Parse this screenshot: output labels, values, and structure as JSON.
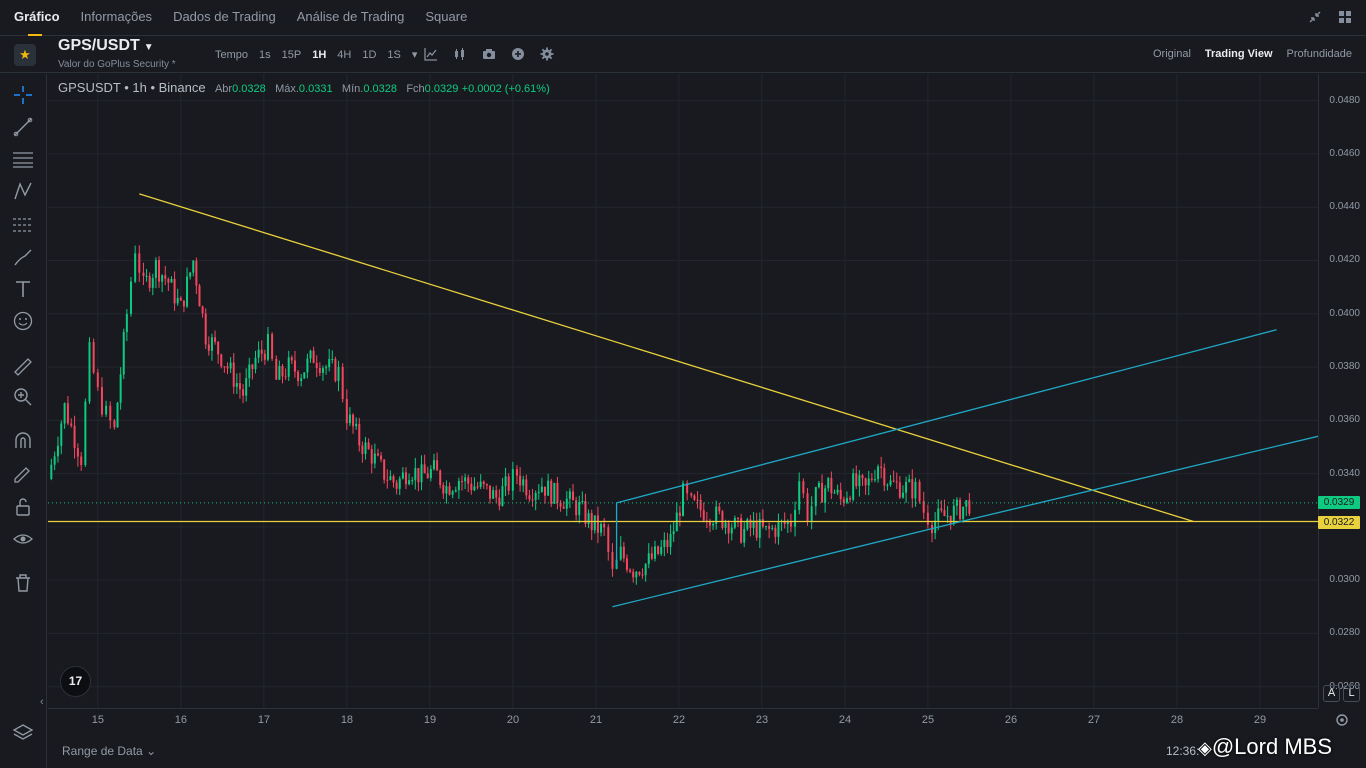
{
  "nav": {
    "tabs": [
      "Gráfico",
      "Informações",
      "Dados de Trading",
      "Análise de Trading",
      "Square"
    ]
  },
  "header": {
    "symbol": "GPS/USDT",
    "subtitle": "Valor do GoPlus Security *",
    "time_label": "Tempo",
    "intervals": [
      "1s",
      "15P",
      "1H",
      "4H",
      "1D",
      "1S"
    ],
    "active_interval": "1H",
    "views": [
      "Original",
      "Trading View",
      "Profundidade"
    ],
    "active_view": "Trading View"
  },
  "legend": {
    "title": "GPSUSDT • 1h • Binance",
    "open_label": "Abr",
    "open": "0.0328",
    "high_label": "Máx.",
    "high": "0.0331",
    "low_label": "Mín.",
    "low": "0.0328",
    "close_label": "Fch",
    "close": "0.0329",
    "change": "+0.0002 (+0.61%)"
  },
  "y_axis": [
    "0.0480",
    "0.0460",
    "0.0440",
    "0.0420",
    "0.0400",
    "0.0380",
    "0.0360",
    "0.0340",
    "0.0320",
    "0.0300",
    "0.0280",
    "0.0260"
  ],
  "x_axis": [
    "15",
    "16",
    "17",
    "18",
    "19",
    "20",
    "21",
    "22",
    "23",
    "24",
    "25",
    "26",
    "27",
    "28",
    "29"
  ],
  "price_tags": {
    "current": "0.0329",
    "level": "0.0322"
  },
  "colors": {
    "up": "#0ecb81",
    "down": "#f6465d",
    "trendline": "#e8d13c",
    "channel": "#1fa8c4",
    "accent": "#f0b90b"
  },
  "bottom": {
    "range_label": "Range de Data",
    "clock": "12:36:",
    "watermark": "@Lord MBS"
  },
  "scale_buttons": [
    "A",
    "L"
  ],
  "tv_logo": "17",
  "chart_data": {
    "type": "candlestick",
    "symbol": "GPSUSDT",
    "interval": "1h",
    "ylim": [
      0.0252,
      0.049
    ],
    "xlim": [
      14.4,
      29.7
    ],
    "closes": [
      [
        14.4,
        0.0338
      ],
      [
        14.6,
        0.0365
      ],
      [
        14.8,
        0.0346
      ],
      [
        14.9,
        0.0385
      ],
      [
        15.0,
        0.037
      ],
      [
        15.1,
        0.0362
      ],
      [
        15.2,
        0.0356
      ],
      [
        15.35,
        0.04
      ],
      [
        15.45,
        0.0425
      ],
      [
        15.55,
        0.041
      ],
      [
        15.7,
        0.0418
      ],
      [
        15.85,
        0.0412
      ],
      [
        16.0,
        0.0402
      ],
      [
        16.15,
        0.042
      ],
      [
        16.3,
        0.0392
      ],
      [
        16.45,
        0.0386
      ],
      [
        16.6,
        0.0378
      ],
      [
        16.75,
        0.037
      ],
      [
        16.9,
        0.0383
      ],
      [
        17.05,
        0.0388
      ],
      [
        17.15,
        0.0375
      ],
      [
        17.3,
        0.038
      ],
      [
        17.45,
        0.0378
      ],
      [
        17.6,
        0.0384
      ],
      [
        17.75,
        0.038
      ],
      [
        17.9,
        0.0378
      ],
      [
        18.0,
        0.0362
      ],
      [
        18.15,
        0.0352
      ],
      [
        18.3,
        0.0347
      ],
      [
        18.45,
        0.034
      ],
      [
        18.6,
        0.0336
      ],
      [
        18.75,
        0.0342
      ],
      [
        18.9,
        0.0339
      ],
      [
        19.05,
        0.0341
      ],
      [
        19.2,
        0.0335
      ],
      [
        19.35,
        0.0338
      ],
      [
        19.5,
        0.0336
      ],
      [
        19.65,
        0.0334
      ],
      [
        19.8,
        0.0331
      ],
      [
        19.95,
        0.0336
      ],
      [
        20.05,
        0.034
      ],
      [
        20.2,
        0.0334
      ],
      [
        20.35,
        0.0336
      ],
      [
        20.5,
        0.0332
      ],
      [
        20.65,
        0.033
      ],
      [
        20.8,
        0.0327
      ],
      [
        20.95,
        0.0321
      ],
      [
        21.1,
        0.0318
      ],
      [
        21.2,
        0.0302
      ],
      [
        21.3,
        0.031
      ],
      [
        21.45,
        0.0304
      ],
      [
        21.6,
        0.0306
      ],
      [
        21.75,
        0.031
      ],
      [
        21.9,
        0.0315
      ],
      [
        22.05,
        0.0332
      ],
      [
        22.15,
        0.0328
      ],
      [
        22.3,
        0.0326
      ],
      [
        22.45,
        0.0324
      ],
      [
        22.6,
        0.0322
      ],
      [
        22.75,
        0.0318
      ],
      [
        22.9,
        0.032
      ],
      [
        23.05,
        0.0318
      ],
      [
        23.2,
        0.032
      ],
      [
        23.35,
        0.0322
      ],
      [
        23.45,
        0.0338
      ],
      [
        23.55,
        0.0325
      ],
      [
        23.65,
        0.0331
      ],
      [
        23.8,
        0.0336
      ],
      [
        23.95,
        0.033
      ],
      [
        24.1,
        0.0336
      ],
      [
        24.25,
        0.0334
      ],
      [
        24.4,
        0.0344
      ],
      [
        24.55,
        0.0336
      ],
      [
        24.7,
        0.0335
      ],
      [
        24.85,
        0.0334
      ],
      [
        24.95,
        0.0326
      ],
      [
        25.05,
        0.0322
      ],
      [
        25.2,
        0.0324
      ],
      [
        25.35,
        0.0326
      ],
      [
        25.5,
        0.0329
      ]
    ],
    "trendline_desc": [
      [
        15.5,
        0.0445
      ],
      [
        28.2,
        0.0322
      ]
    ],
    "horizontal_level": 0.0322,
    "channel_lines": [
      [
        [
          21.2,
          0.029
        ],
        [
          25.4,
          0.0322
        ],
        [
          29.7,
          0.0354
        ]
      ],
      [
        [
          21.25,
          0.0329
        ],
        [
          29.2,
          0.0394
        ]
      ]
    ],
    "channel_left_edge": [
      [
        21.25,
        0.0329
      ],
      [
        21.25,
        0.0305
      ]
    ]
  }
}
